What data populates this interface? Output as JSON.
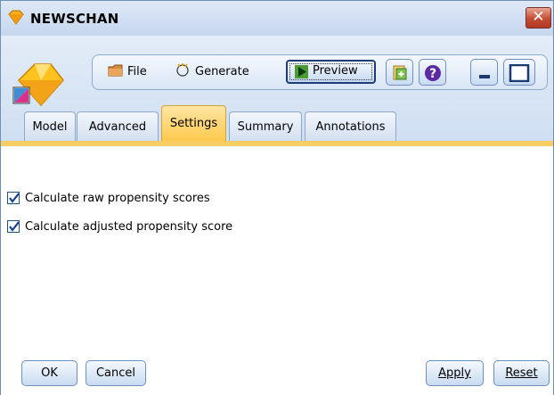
{
  "window": {
    "title": "NEWSCHAN",
    "close_label": "✕"
  },
  "toolbar": {
    "file_label": "File",
    "generate_label": "Generate",
    "preview_label": "Preview"
  },
  "tabs": [
    {
      "label": "Model"
    },
    {
      "label": "Advanced"
    },
    {
      "label": "Settings"
    },
    {
      "label": "Summary"
    },
    {
      "label": "Annotations"
    }
  ],
  "active_tab": "Settings",
  "settings": {
    "raw_propensity": {
      "label": "Calculate raw propensity scores",
      "checked": true
    },
    "adjusted_propensity": {
      "label": "Calculate adjusted propensity score",
      "checked": true
    }
  },
  "buttons": {
    "ok": "OK",
    "cancel": "Cancel",
    "apply": "Apply",
    "reset": "Reset"
  },
  "colors": {
    "accent_tab": "#ffc94d",
    "close": "#c44b33",
    "frame": "#c8daf0"
  }
}
